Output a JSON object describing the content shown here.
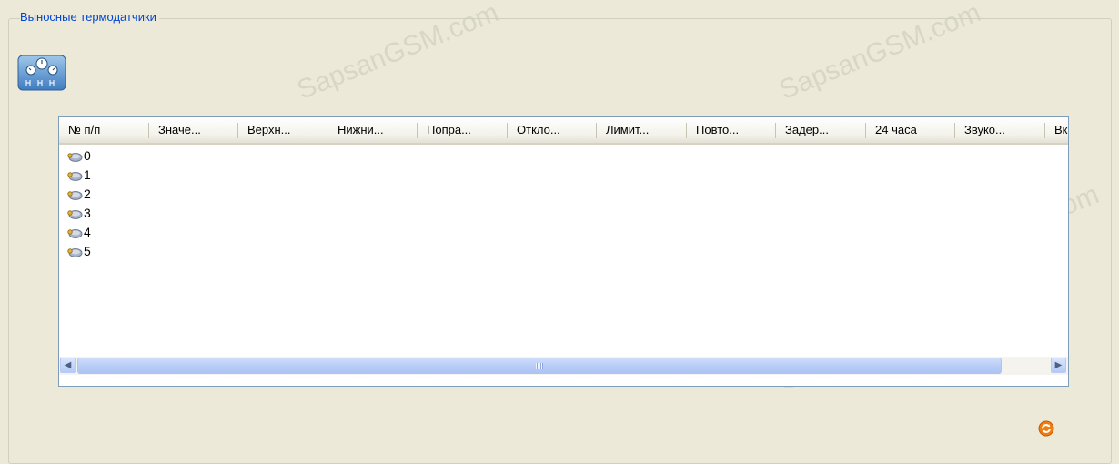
{
  "group": {
    "title": "Выносные термодатчики"
  },
  "toolbar": {
    "sensor_icon": "thermosensors-icon"
  },
  "table": {
    "columns": [
      "№ п/п",
      "Значе...",
      "Верхн...",
      "Нижни...",
      "Попра...",
      "Откло...",
      "Лимит...",
      "Повто...",
      "Задер...",
      "24 часа",
      "Звуко...",
      "Вк."
    ],
    "rows": [
      "0",
      "1",
      "2",
      "3",
      "4",
      "5"
    ],
    "row_icon": "sensor-icon"
  },
  "actions": {
    "refresh_icon": "refresh-icon",
    "refresh_color": "#f07d12"
  },
  "watermark": "SapsanGSM.com"
}
